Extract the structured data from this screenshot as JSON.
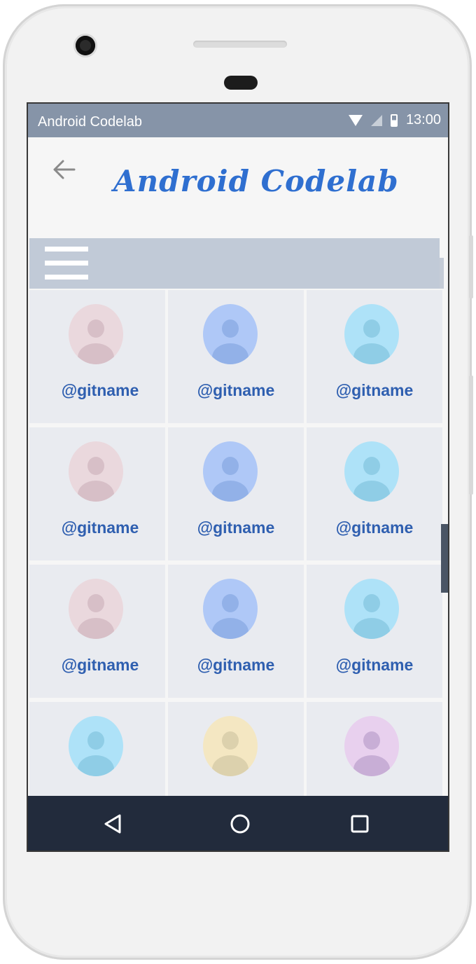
{
  "status_bar": {
    "app_name": "Android Codelab",
    "time": "13:00"
  },
  "app_bar": {
    "title": "Android Codelab"
  },
  "grid": {
    "items": [
      {
        "handle": "@gitname",
        "avatar_bg": "#ead8dd",
        "avatar_fg": "#d7bfc7"
      },
      {
        "handle": "@gitname",
        "avatar_bg": "#afc8f7",
        "avatar_fg": "#92b1e8"
      },
      {
        "handle": "@gitname",
        "avatar_bg": "#aee2f8",
        "avatar_fg": "#8fcde6"
      },
      {
        "handle": "@gitname",
        "avatar_bg": "#ead8dd",
        "avatar_fg": "#d7bfc7"
      },
      {
        "handle": "@gitname",
        "avatar_bg": "#afc8f7",
        "avatar_fg": "#92b1e8"
      },
      {
        "handle": "@gitname",
        "avatar_bg": "#aee2f8",
        "avatar_fg": "#8fcde6"
      },
      {
        "handle": "@gitname",
        "avatar_bg": "#ead8dd",
        "avatar_fg": "#d7bfc7"
      },
      {
        "handle": "@gitname",
        "avatar_bg": "#afc8f7",
        "avatar_fg": "#92b1e8"
      },
      {
        "handle": "@gitname",
        "avatar_bg": "#aee2f8",
        "avatar_fg": "#8fcde6"
      },
      {
        "handle": "",
        "avatar_bg": "#aee2f8",
        "avatar_fg": "#8fcde6"
      },
      {
        "handle": "",
        "avatar_bg": "#f4e7c2",
        "avatar_fg": "#dcd1ad"
      },
      {
        "handle": "",
        "avatar_bg": "#e8d0ee",
        "avatar_fg": "#c8aed6"
      }
    ]
  },
  "icons": {
    "back": "arrow-back-icon",
    "menu": "hamburger-menu-icon",
    "nav_back": "triangle-back-icon",
    "nav_home": "circle-home-icon",
    "nav_recents": "square-recents-icon"
  },
  "colors": {
    "status_bar": "#8694a8",
    "title": "#2f6fd0",
    "menu_bar": "#c1cad7",
    "cell": "#e9ebf0",
    "handle": "#2f5fb0",
    "nav_bar": "#222b3c"
  }
}
